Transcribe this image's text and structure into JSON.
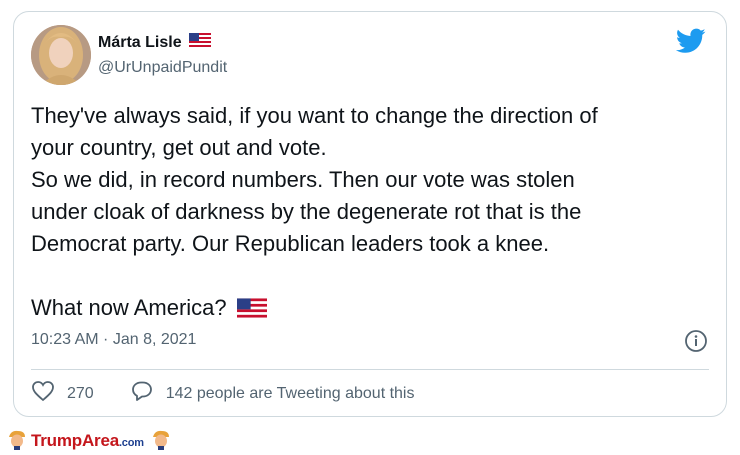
{
  "tweet": {
    "author_name": "Márta Lisle",
    "author_handle": "@UrUnpaidPundit",
    "body_lines_1": [
      "They've always said, if you want to change the direction of",
      "your country, get out and vote."
    ],
    "body_lines_2": [
      "So we did, in record numbers. Then our vote was stolen",
      "under cloak of darkness by the degenerate rot that is the",
      "Democrat party. Our Republican leaders took a knee."
    ],
    "closing": "What now America?",
    "timestamp": "10:23 AM · Jan 8, 2021",
    "like_count": "270",
    "reply_text": "142 people are Tweeting about this"
  },
  "icons": {
    "platform": "twitter-bird-icon",
    "flag": "us-flag-icon",
    "info": "info-icon",
    "like": "heart-icon",
    "reply": "speech-bubble-icon"
  },
  "colors": {
    "bird": "#1d9bf0",
    "secondary_text": "#536471",
    "border": "#cfd9de",
    "brand_red": "#c4161c",
    "brand_blue": "#1d3f8f"
  },
  "watermark": {
    "brand_main": "TrumpArea",
    "brand_domain": ".com"
  }
}
